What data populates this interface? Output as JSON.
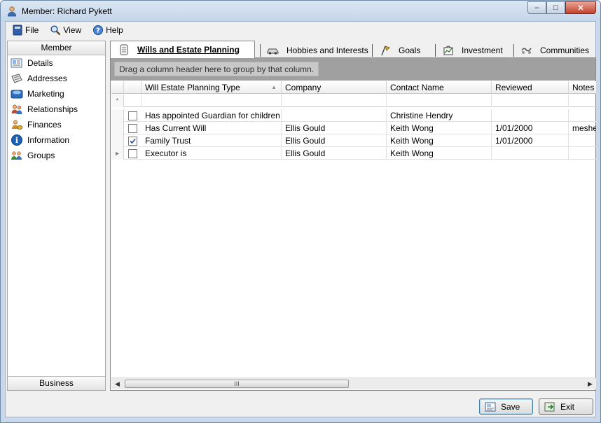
{
  "window": {
    "title": "Member: Richard Pykett",
    "minimize_glyph": "–",
    "maximize_glyph": "□",
    "close_glyph": "✕"
  },
  "menu": {
    "file": "File",
    "view": "View",
    "help": "Help"
  },
  "nav": {
    "header": "Member",
    "footer": "Business",
    "items": [
      {
        "label": "Details",
        "icon": "details-icon"
      },
      {
        "label": "Addresses",
        "icon": "addresses-icon"
      },
      {
        "label": "Marketing",
        "icon": "marketing-icon"
      },
      {
        "label": "Relationships",
        "icon": "relationships-icon"
      },
      {
        "label": "Finances",
        "icon": "finances-icon"
      },
      {
        "label": "Information",
        "icon": "information-icon"
      },
      {
        "label": "Groups",
        "icon": "groups-icon"
      }
    ]
  },
  "tabs": [
    {
      "label": "Wills and Estate Planning",
      "active": true,
      "icon": "scroll-icon"
    },
    {
      "label": "Hobbies and Interests",
      "active": false,
      "icon": "car-icon"
    },
    {
      "label": "Goals",
      "active": false,
      "icon": "flag-icon"
    },
    {
      "label": "Investment",
      "active": false,
      "icon": "investment-icon"
    },
    {
      "label": "Communities",
      "active": false,
      "icon": "communities-icon"
    }
  ],
  "grid": {
    "group_hint": "Drag a column header here to group by that column.",
    "new_row_marker": "*",
    "columns": [
      "Will Estate Planning Type",
      "Company",
      "Contact Name",
      "Reviewed",
      "Notes"
    ],
    "rows": [
      {
        "checked": false,
        "type": "Has appointed Guardian for children",
        "company": "",
        "contact": "Christine Hendry",
        "reviewed": "",
        "notes": ""
      },
      {
        "checked": false,
        "type": "Has Current Will",
        "company": "Ellis Gould",
        "contact": "Keith Wong",
        "reviewed": "1/01/2000",
        "notes": "meshes"
      },
      {
        "checked": true,
        "type": "Family Trust",
        "company": "Ellis Gould",
        "contact": "Keith Wong",
        "reviewed": "1/01/2000",
        "notes": ""
      },
      {
        "checked": false,
        "type": "Executor is",
        "company": "Ellis Gould",
        "contact": "Keith Wong",
        "reviewed": "",
        "notes": ""
      }
    ],
    "scroll_thumb_grip": "III"
  },
  "buttons": {
    "save": "Save",
    "exit": "Exit"
  },
  "colors": {
    "accent": "#3c7fb1",
    "group_area": "#a0a0a0"
  }
}
